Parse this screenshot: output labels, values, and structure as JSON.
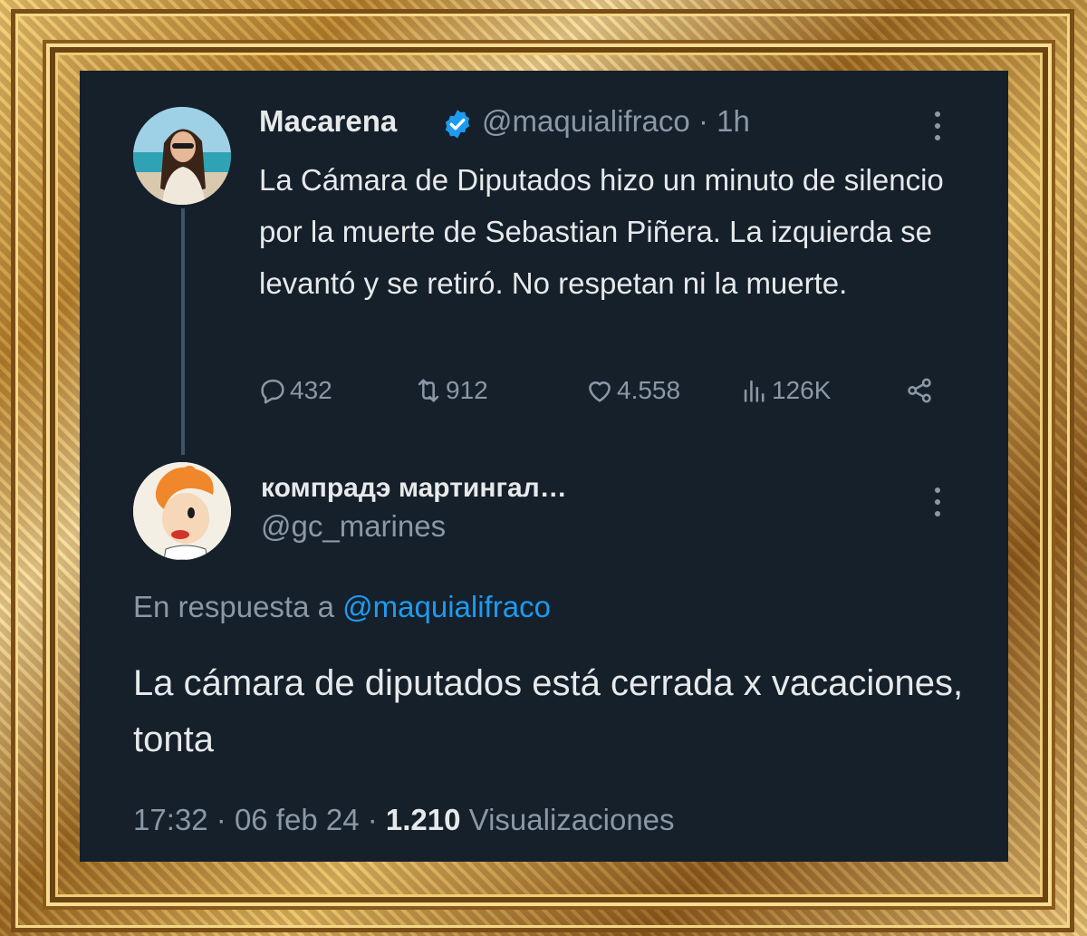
{
  "tweet": {
    "author_name": "Macarena",
    "verified_icon": "verified-badge-icon",
    "handle": "@maquialifraco",
    "separator": "·",
    "time_ago": "1h",
    "text": "La Cámara de Diputados hizo un minuto de silencio por la muerte de Sebastian Piñera. La izquierda se levantó y se retiró. No respetan ni la muerte.",
    "actions": {
      "replies": "432",
      "retweets": "912",
      "likes": "4.558",
      "views": "126K"
    }
  },
  "reply": {
    "author_name": "компрадэ мартингал…",
    "handle": "@gc_marines",
    "replying_prefix": "En respuesta a",
    "replying_to": "@maquialifraco",
    "text": "La cámara de diputados está cerrada x vacaciones,  tonta",
    "time": "17:32",
    "date": "06 feb 24",
    "sep": "·",
    "views_count": "1.210",
    "views_label": "Visualizaciones"
  },
  "colors": {
    "background": "#15202b",
    "primary_text": "#e7e9ea",
    "secondary_text": "#8b98a5",
    "accent": "#1d9bf0",
    "frame_gold": "#c9993c"
  }
}
